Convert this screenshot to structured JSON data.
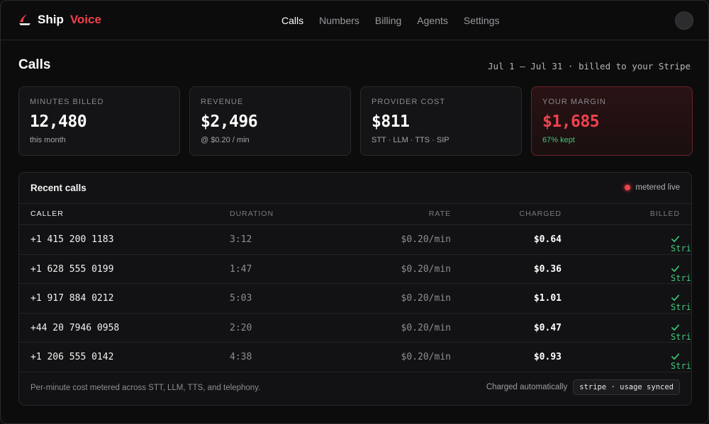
{
  "brand": {
    "part1": "Ship",
    "part2": "Voice",
    "logo_icon": "sail-icon"
  },
  "nav": [
    {
      "label": "Calls",
      "active": true
    },
    {
      "label": "Numbers",
      "active": false
    },
    {
      "label": "Billing",
      "active": false
    },
    {
      "label": "Agents",
      "active": false
    },
    {
      "label": "Settings",
      "active": false
    }
  ],
  "page": {
    "title": "Calls",
    "date_range": "Jul 1 – Jul 31 · billed to your Stripe"
  },
  "cards": [
    {
      "label": "MINUTES BILLED",
      "value": "12,480",
      "sub": "this month"
    },
    {
      "label": "REVENUE",
      "value": "$2,496",
      "sub": "@ $0.20 / min"
    },
    {
      "label": "PROVIDER COST",
      "value": "$811",
      "sub": "STT · LLM · TTS · SIP"
    },
    {
      "label": "YOUR MARGIN",
      "value": "$1,685",
      "sub": "67% kept"
    }
  ],
  "table": {
    "title": "Recent calls",
    "live_label": "metered live",
    "columns": [
      "CALLER",
      "DURATION",
      "RATE",
      "CHARGED",
      "BILLED"
    ],
    "rows": [
      {
        "caller": "+1 415 200 1183",
        "duration": "3:12",
        "rate": "$0.20/min",
        "charged": "$0.64",
        "billed": "Stripe"
      },
      {
        "caller": "+1 628 555 0199",
        "duration": "1:47",
        "rate": "$0.20/min",
        "charged": "$0.36",
        "billed": "Stripe"
      },
      {
        "caller": "+1 917 884 0212",
        "duration": "5:03",
        "rate": "$0.20/min",
        "charged": "$1.01",
        "billed": "Stripe"
      },
      {
        "caller": "+44 20 7946 0958",
        "duration": "2:20",
        "rate": "$0.20/min",
        "charged": "$0.47",
        "billed": "Stripe"
      },
      {
        "caller": "+1 206 555 0142",
        "duration": "4:38",
        "rate": "$0.20/min",
        "charged": "$0.93",
        "billed": "Stripe"
      }
    ],
    "footer_note": "Per-minute cost metered across STT, LLM, TTS, and telephony.",
    "footer_right_label": "Charged automatically",
    "footer_badge": "stripe · usage synced"
  },
  "colors": {
    "accent": "#f0424d",
    "success": "#3ec97a",
    "background": "#0c0c0d"
  }
}
